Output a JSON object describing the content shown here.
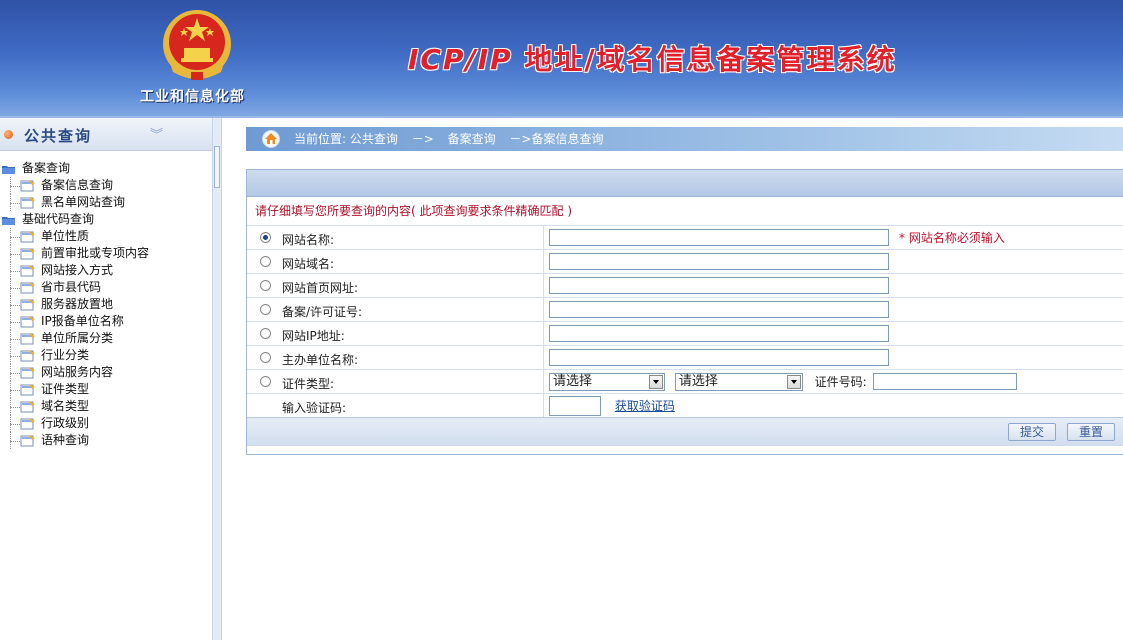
{
  "header": {
    "ministry": "工业和信息化部",
    "title_latin": "ICP/IP",
    "title_rest": " 地址/域名信息备案管理系统"
  },
  "sidebar": {
    "title": "公共查询",
    "collapse_icon": "double-chevron-down-icon",
    "groups": [
      {
        "label": "备案查询",
        "items": [
          {
            "label": "备案信息查询"
          },
          {
            "label": "黑名单网站查询"
          }
        ]
      },
      {
        "label": "基础代码查询",
        "items": [
          {
            "label": "单位性质"
          },
          {
            "label": "前置审批或专项内容"
          },
          {
            "label": "网站接入方式"
          },
          {
            "label": "省市县代码"
          },
          {
            "label": "服务器放置地"
          },
          {
            "label": "IP报备单位名称"
          },
          {
            "label": "单位所属分类"
          },
          {
            "label": "行业分类"
          },
          {
            "label": "网站服务内容"
          },
          {
            "label": "证件类型"
          },
          {
            "label": "域名类型"
          },
          {
            "label": "行政级别"
          },
          {
            "label": "语种查询"
          }
        ]
      }
    ]
  },
  "breadcrumb": {
    "part1": "当前位置: 公共查询",
    "arrow1": "－>",
    "part2": "备案查询",
    "part3": "－>备案信息查询"
  },
  "form": {
    "hint": "请仔细填写您所要查询的内容( 此项查询要求条件精确匹配 )",
    "fields": [
      {
        "label": "网站名称:",
        "value": "",
        "checked": true,
        "note": "* 网站名称必须输入"
      },
      {
        "label": "网站域名:",
        "value": "",
        "checked": false
      },
      {
        "label": "网站首页网址:",
        "value": "",
        "checked": false
      },
      {
        "label": "备案/许可证号:",
        "value": "",
        "checked": false
      },
      {
        "label": "网站IP地址:",
        "value": "",
        "checked": false
      },
      {
        "label": "主办单位名称:",
        "value": "",
        "checked": false
      }
    ],
    "cert": {
      "label": "证件类型:",
      "select1": "请选择",
      "select2": "请选择",
      "number_label": "证件号码:",
      "number_value": ""
    },
    "captcha": {
      "label": "输入验证码:",
      "value": "",
      "link": "获取验证码"
    },
    "buttons": {
      "submit": "提交",
      "reset": "重置"
    }
  },
  "colors": {
    "header_blue": "#3f6bc4",
    "title_red": "#e0202a",
    "hint_red": "#b0102a",
    "link_blue": "#1a4a9a"
  }
}
